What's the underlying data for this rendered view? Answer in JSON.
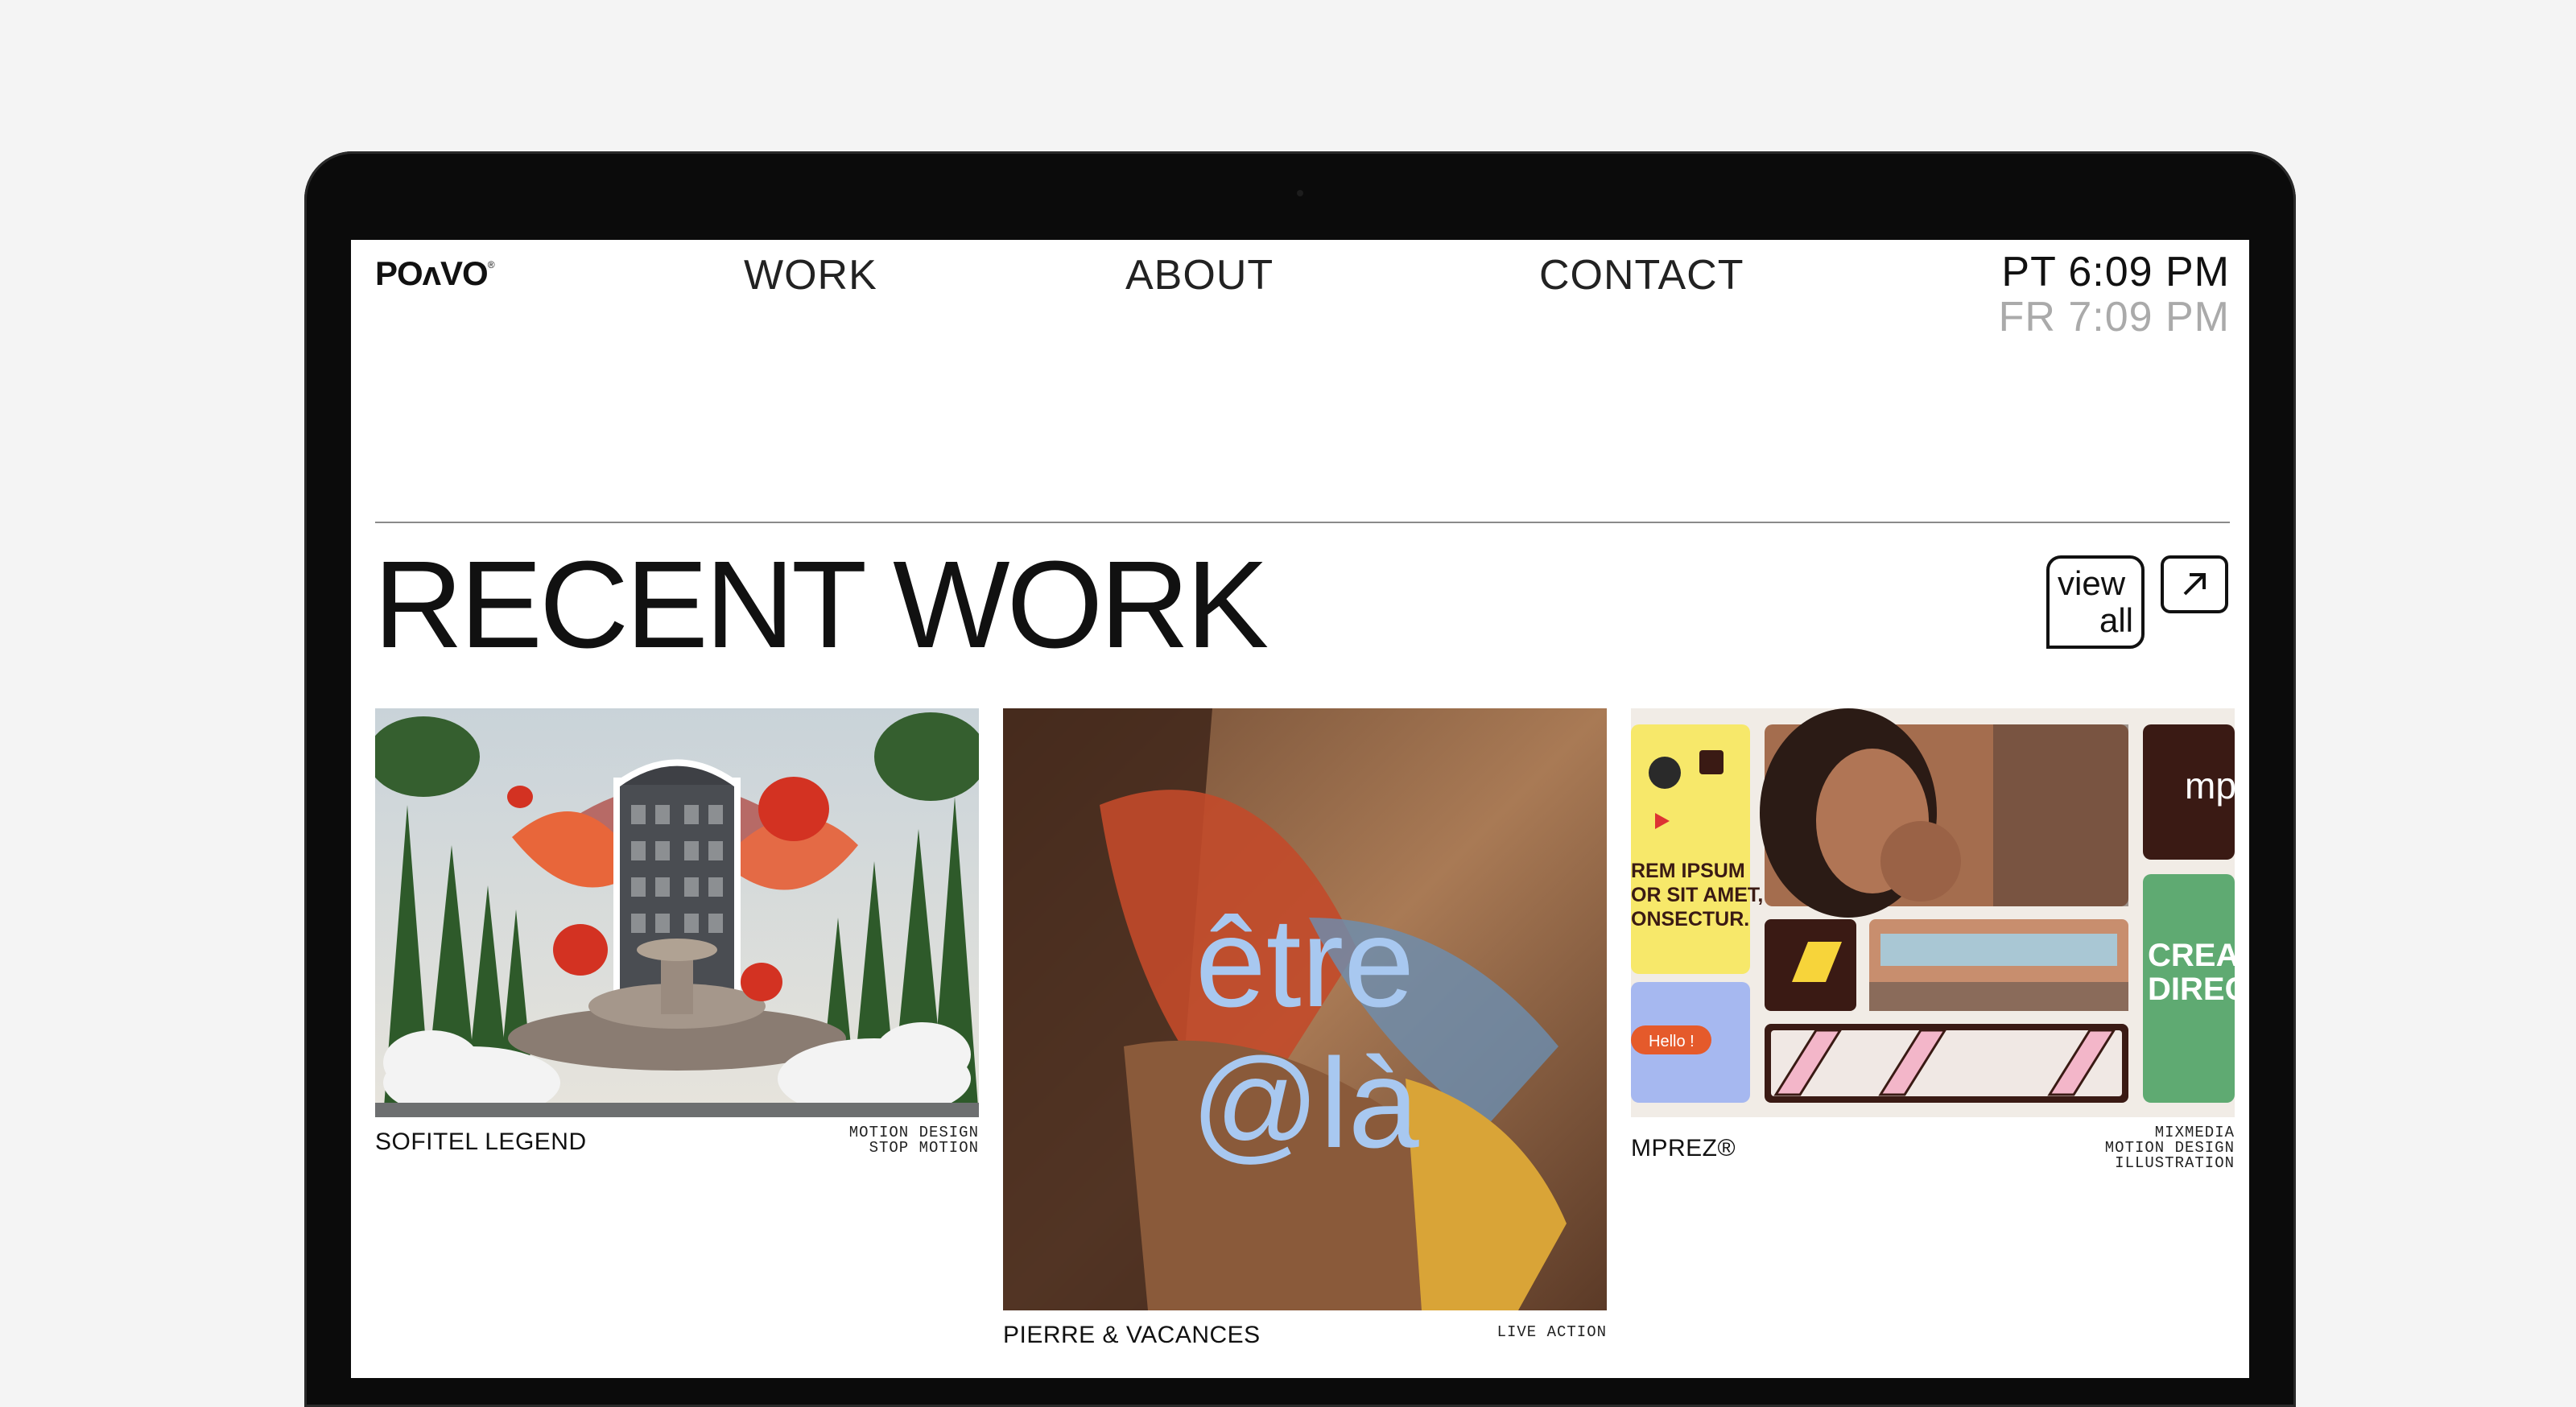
{
  "header": {
    "logo": "POᴧVO",
    "logo_mark": "®",
    "nav": [
      "WORK",
      "ABOUT",
      "CONTACT"
    ]
  },
  "clocks": {
    "primary": "PT 6:09 PM",
    "secondary": "FR 7:09 PM"
  },
  "section": {
    "title": "RECENT WORK",
    "view_all_line1": "view",
    "view_all_line2": "all"
  },
  "projects": [
    {
      "title": "SOFITEL LEGEND",
      "tags": [
        "MOTION DESIGN",
        "STOP MOTION"
      ]
    },
    {
      "title": "PIERRE & VACANCES",
      "tags": [
        "LIVE ACTION"
      ],
      "overlay_line1": "être",
      "overlay_line2": "@là"
    },
    {
      "title": "MPREZ®",
      "tags": [
        "MIXMEDIA",
        "MOTION DESIGN",
        "ILLUSTRATION"
      ],
      "poster_text": [
        "REM IPSUM",
        "OR SIT AMET,",
        "ONSECTUR."
      ],
      "hello": "Hello !",
      "mp": "mp",
      "creat": [
        "CREAT",
        "DIRECT"
      ]
    }
  ],
  "colors": {
    "overlay_text": "#a8c8f0",
    "mprez_brown": "#3a1a14",
    "mprez_green": "#5faa72",
    "mprez_yellow": "#f7e86a",
    "mprez_blue": "#a6b8f0"
  }
}
